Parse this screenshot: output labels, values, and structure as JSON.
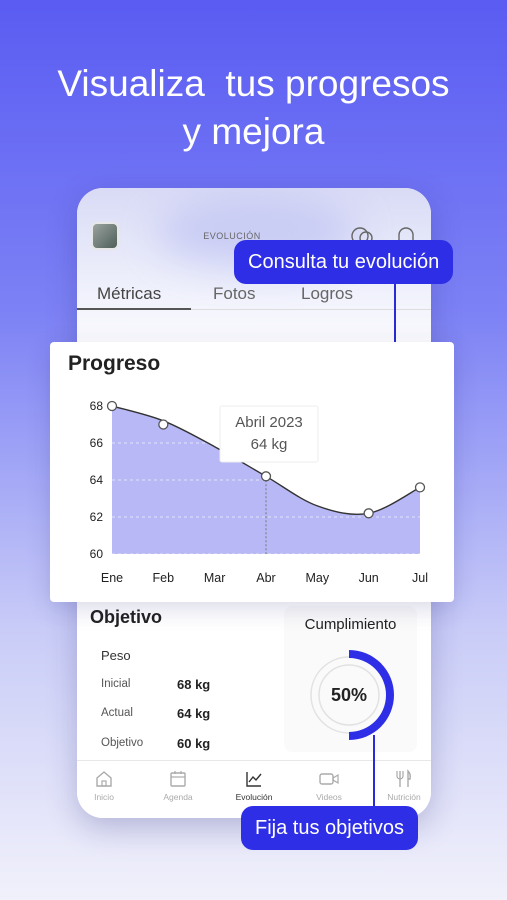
{
  "headline": {
    "line1": "Visualiza  tus progresos",
    "line2": "y mejora"
  },
  "app": {
    "title": "EVOLUCIÓN",
    "tabs": [
      {
        "label": "Métricas",
        "active": true
      },
      {
        "label": "Fotos",
        "active": false
      },
      {
        "label": "Logros",
        "active": false
      }
    ]
  },
  "callouts": {
    "evolution": "Consulta tu evolución",
    "goals": "Fija tus objetivos"
  },
  "progress": {
    "title": "Progreso",
    "tooltip": {
      "date": "Abril 2023",
      "value": "64 kg"
    }
  },
  "chart_data": {
    "type": "area",
    "title": "Progreso",
    "categories": [
      "Ene",
      "Feb",
      "Mar",
      "Abr",
      "May",
      "Jun",
      "Jul"
    ],
    "markers": [
      {
        "x": "Ene",
        "y": 68
      },
      {
        "x": "Feb",
        "y": 67
      },
      {
        "x": "Abr",
        "y": 64.2
      },
      {
        "x": "Jun",
        "y": 62.2
      },
      {
        "x": "Jul",
        "y": 63.6
      }
    ],
    "curve": [
      68,
      67.2,
      65.8,
      64.2,
      62.6,
      62.2,
      63.6
    ],
    "yticks": [
      60,
      62,
      64,
      66,
      68
    ],
    "ylim": [
      60,
      68
    ],
    "highlight": "Abr",
    "fill_color": "#b7b8f5",
    "line_color": "#333333",
    "grid": true
  },
  "objetivo": {
    "title": "Objetivo",
    "peso_label": "Peso",
    "rows": [
      {
        "label": "Inicial",
        "value": "68 kg"
      },
      {
        "label": "Actual",
        "value": "64 kg"
      },
      {
        "label": "Objetivo",
        "value": "60 kg"
      }
    ]
  },
  "cumplimiento": {
    "title": "Cumplimiento",
    "percent_label": "50%",
    "fraction": 0.5,
    "color": "#2e2ee6"
  },
  "nav": [
    {
      "label": "Inicio",
      "icon": "home-icon",
      "active": false
    },
    {
      "label": "Agenda",
      "icon": "calendar-icon",
      "active": false
    },
    {
      "label": "Evolución",
      "icon": "chart-icon",
      "active": true
    },
    {
      "label": "Videos",
      "icon": "video-icon",
      "active": false
    },
    {
      "label": "Nutrición",
      "icon": "cutlery-icon",
      "active": false
    }
  ]
}
